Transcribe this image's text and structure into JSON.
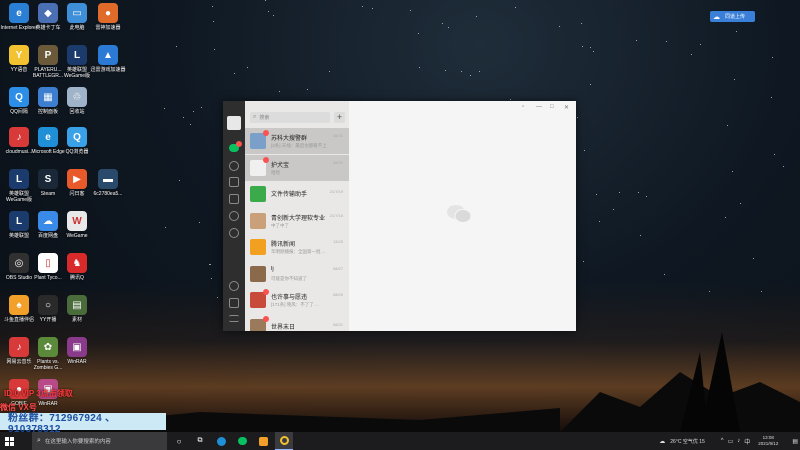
{
  "desktop": {
    "icons": [
      {
        "label": "Internet Explorer",
        "color": "#2a7fd4",
        "glyph": "e"
      },
      {
        "label": "英雄卡丁车",
        "color": "#4a6fb3",
        "glyph": "◆"
      },
      {
        "label": "此电脑",
        "color": "#3e8fd8",
        "glyph": "▭"
      },
      {
        "label": "雷神加速器",
        "color": "#e06a2a",
        "glyph": "●"
      },
      {
        "label": "YY语音",
        "color": "#f2c230",
        "glyph": "Y"
      },
      {
        "label": "PLAYERU... BATTLEGR...",
        "color": "#6b5a3a",
        "glyph": "P"
      },
      {
        "label": "英雄联盟 WeGame版",
        "color": "#1a3b6b",
        "glyph": "L"
      },
      {
        "label": "迅雷游戏加速器",
        "color": "#2b7ad6",
        "glyph": "▲"
      },
      {
        "label": "QQ间隔",
        "color": "#2d8ee8",
        "glyph": "Q"
      },
      {
        "label": "控制面板",
        "color": "#3d7ed1",
        "glyph": "▦"
      },
      {
        "label": "回收站",
        "color": "#9fb3c9",
        "glyph": "♲"
      },
      {
        "label": "cloudmusi...",
        "color": "#d83a3a",
        "glyph": "♪"
      },
      {
        "label": "Microsoft Edge",
        "color": "#1f8fd8",
        "glyph": "e"
      },
      {
        "label": "QQ浏览器",
        "color": "#3aa0e8",
        "glyph": "Q"
      },
      {
        "label": "英雄联盟 WeGame版",
        "color": "#1a3b6b",
        "glyph": "L"
      },
      {
        "label": "Steam",
        "color": "#1b2838",
        "glyph": "S"
      },
      {
        "label": "闪日客",
        "color": "#e85a2a",
        "glyph": "▶"
      },
      {
        "label": "6c2780ea5...",
        "color": "#2a4a6b",
        "glyph": "▬"
      },
      {
        "label": "英雄联盟",
        "color": "#1a3b6b",
        "glyph": "L"
      },
      {
        "label": "百度网盘",
        "color": "#3a8ae8",
        "glyph": "☁"
      },
      {
        "label": "WeGame",
        "color": "#e8e8e8",
        "glyph": "W"
      },
      {
        "label": "OBS Studio",
        "color": "#303030",
        "glyph": "◎"
      },
      {
        "label": "Plant Tyco...",
        "color": "#ffffff",
        "glyph": "▯"
      },
      {
        "label": "腾讯Q",
        "color": "#d82a2a",
        "glyph": "♞"
      },
      {
        "label": "斗鱼直播伴侣",
        "color": "#f2a02a",
        "glyph": "♠"
      },
      {
        "label": "YY开播",
        "color": "#2a2a2a",
        "glyph": "○"
      },
      {
        "label": "素材",
        "color": "#4a6b3a",
        "glyph": "▤"
      },
      {
        "label": "网易云音乐",
        "color": "#d83a3a",
        "glyph": "♪"
      },
      {
        "label": "Plants vs. Zombies G...",
        "color": "#5a8a3a",
        "glyph": "✿"
      },
      {
        "label": "WinRAR",
        "color": "#8a3a8a",
        "glyph": "▣"
      },
      {
        "label": "GOBIE",
        "color": "#d83a3a",
        "glyph": "●"
      },
      {
        "label": "WinRAR",
        "color": "#b84a8a",
        "glyph": "▣"
      }
    ]
  },
  "overlay": {
    "red_text_1": "ID:0 VIP 3点击领取",
    "red_text_2": "微信 VX号",
    "fan_group": "粉丝群：712967924 、910378312"
  },
  "cloud_button": {
    "label": "同道上传"
  },
  "wechat": {
    "search_placeholder": "搜索",
    "add_label": "+",
    "window_controls": [
      "▫",
      "—",
      "□",
      "✕"
    ],
    "chats": [
      {
        "name": "苏科大搜警群",
        "msg": "[2条] 天线：最后也都看不上",
        "time": "08/31",
        "color": "#7aa0c9",
        "badge": true,
        "selected": true
      },
      {
        "name": "护犬宝",
        "msg": "哈哈",
        "time": "08/31",
        "color": "#f0f0f0",
        "badge": true,
        "selected": true
      },
      {
        "name": "文件传输助手",
        "msg": "",
        "time": "21/7/19",
        "color": "#3aaa4a",
        "badge": false,
        "selected": false
      },
      {
        "name": "青创新大学理软专业",
        "msg": "中了中了",
        "time": "21/7/16",
        "color": "#c9a07a",
        "badge": false,
        "selected": false
      },
      {
        "name": "腾讯新闻",
        "msg": "华明刚播报：全国第一批 ...",
        "time": "13:03",
        "color": "#f2a020",
        "badge": false,
        "selected": false
      },
      {
        "name": "lj",
        "msg": "可能是你不知道了",
        "time": "08/27",
        "color": "#8a6a4a",
        "badge": false,
        "selected": false
      },
      {
        "name": "也许事与愿违",
        "msg": "[171条] 晓风：不了了 ...",
        "time": "08/25",
        "color": "#c84a3a",
        "badge": true,
        "selected": false
      },
      {
        "name": "世界末日",
        "msg": "",
        "time": "08/21",
        "color": "#9a7a5a",
        "badge": true,
        "selected": false
      }
    ]
  },
  "taskbar": {
    "search_placeholder": "在这里输入你要搜索的内容",
    "weather": "26°C 空气优 15",
    "time": "13:08",
    "date": "2021/9/12"
  }
}
